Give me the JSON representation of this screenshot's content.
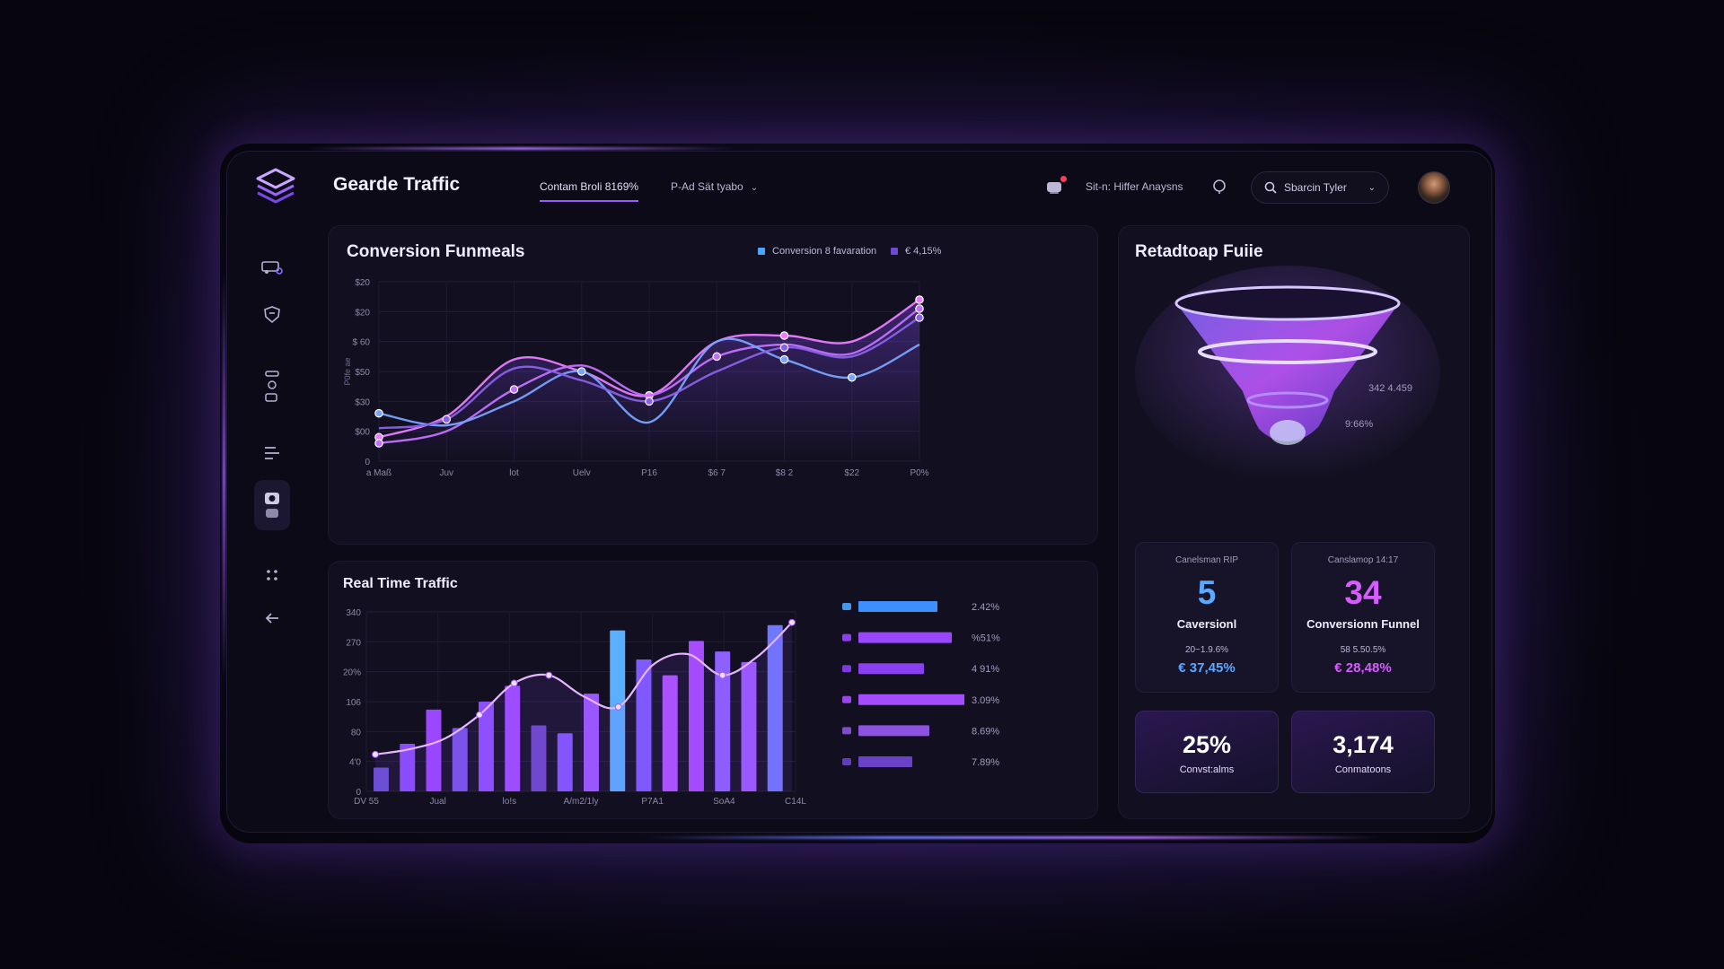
{
  "app": {
    "title": "Gearde Traffic"
  },
  "header": {
    "tabs": [
      {
        "label": "Contam Broli 8169%"
      },
      {
        "label": "P-Ad Sät tyabo"
      }
    ],
    "user_label": "Sit-n: Hiffer Anaysns",
    "search_placeholder": "Sbarcin Tyler"
  },
  "sidebar": {
    "items": [
      "vehicle-icon",
      "shield-icon",
      "stack-icon",
      "lock-icon",
      "list-icon",
      "camera-icon",
      "grid-icon",
      "back-arrow-icon"
    ]
  },
  "conversion_panel": {
    "title": "Conversion Funmeals",
    "legend": [
      {
        "label": "Conversion 8 favaration",
        "color": "#4aa7ff"
      },
      {
        "label": "€ 4,15%",
        "color": "#7048d8"
      }
    ]
  },
  "realtime_panel": {
    "title": "Real Time Traffic"
  },
  "retention_panel": {
    "title": "Retadtoap Fuiie",
    "funnel_labels": [
      "342 4.459",
      "9:66%"
    ]
  },
  "cards": [
    {
      "sub": "Canelsman RIP",
      "value": "5",
      "label": "Caversionl",
      "meta": "20~1.9.6%",
      "delta": "€ 37,45%",
      "color": "#5aa8ff"
    },
    {
      "sub": "Canslamop 14:17",
      "value": "34",
      "label": "Conversionn Funnel",
      "meta": "58 5.50.5%",
      "delta": "€ 28,48%",
      "color": "#d65cff"
    }
  ],
  "cards2": [
    {
      "value": "25%",
      "label": "Convst:alms"
    },
    {
      "value": "3,174",
      "label": "Conmatoons"
    }
  ],
  "chart_data": [
    {
      "type": "line",
      "title": "Conversion Funmeals",
      "xlabel": "",
      "ylabel": "P0fe ae",
      "x": [
        "a Maß",
        "Juv",
        "lot",
        "Uelv",
        "P16",
        "$6 7",
        "$8 2",
        "$22",
        "P0%"
      ],
      "y_ticks": [
        "0",
        "$00",
        "$30",
        "$50",
        "$ 60",
        "$20",
        "$20"
      ],
      "ylim": [
        0,
        6
      ],
      "grid": true,
      "legend_position": "top-right",
      "series": [
        {
          "name": "Conversion 8 favaration",
          "color": "#ec7dff",
          "values": [
            0.8,
            1.5,
            3.4,
            3.0,
            2.2,
            4.0,
            4.2,
            4.0,
            5.4
          ]
        },
        {
          "color": "#c271ff",
          "values": [
            0.6,
            1.0,
            2.4,
            3.2,
            2.2,
            3.5,
            3.9,
            3.6,
            5.1
          ]
        },
        {
          "color": "#79a3ff",
          "values": [
            1.6,
            1.2,
            2.0,
            3.0,
            1.3,
            4.0,
            3.4,
            2.8,
            3.9
          ]
        },
        {
          "color": "#8a62e8",
          "values": [
            1.1,
            1.4,
            3.1,
            2.7,
            2.0,
            3.0,
            3.8,
            3.5,
            4.8
          ]
        }
      ]
    },
    {
      "type": "bar",
      "title": "Real Time Traffic",
      "x": [
        "DV 55",
        "Jual",
        "lo!s",
        "A/m2/1ly",
        "P7A1",
        "SoA4",
        "C14L"
      ],
      "y_ticks": [
        "0",
        "4'0",
        "80",
        "106",
        "20%",
        "270",
        "340"
      ],
      "ylim": [
        0,
        340
      ],
      "grid": true,
      "values": [
        45,
        90,
        155,
        120,
        170,
        200,
        125,
        110,
        185,
        305,
        250,
        220,
        285,
        265,
        245,
        315
      ],
      "line_values": [
        70,
        80,
        100,
        145,
        205,
        220,
        180,
        160,
        240,
        260,
        220,
        255,
        320
      ]
    },
    {
      "type": "bar",
      "orientation": "horizontal",
      "categories": [
        "2.42%",
        "%51%",
        "4 91%",
        "3.09%",
        "8.69%",
        "7.89%"
      ],
      "values": [
        88,
        104,
        73,
        118,
        79,
        60
      ],
      "colors": [
        "#3d8fff",
        "#9a46ff",
        "#8a3ff0",
        "#a64cff",
        "#8d52e0",
        "#6a42c8"
      ],
      "icons": [
        "lamp-icon",
        "bolt-icon",
        "truck-icon",
        "pin-icon",
        "car-icon",
        "chat-icon"
      ]
    }
  ]
}
